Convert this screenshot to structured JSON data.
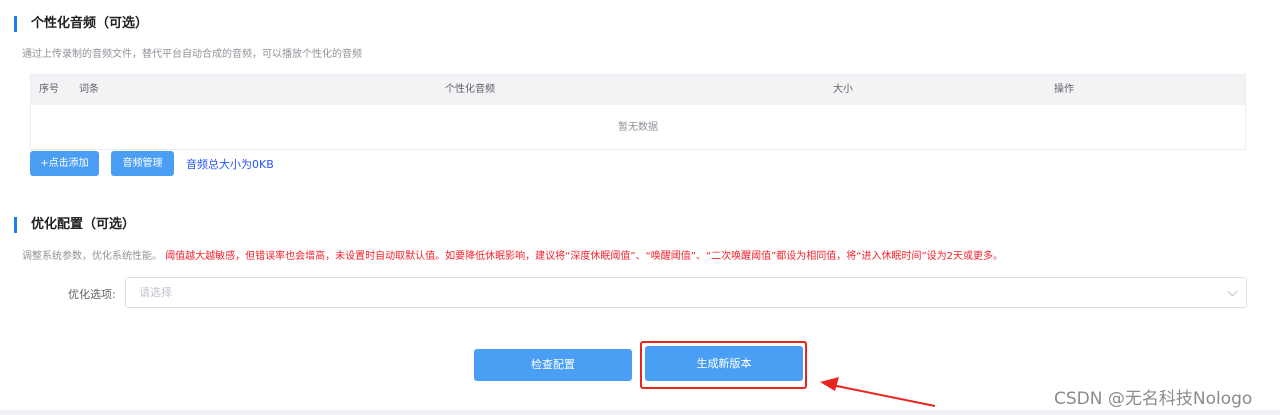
{
  "audio_section": {
    "title": "个性化音频（可选）",
    "description": "通过上传录制的音频文件，替代平台自动合成的音频，可以播放个性化的音频",
    "columns": [
      "序号",
      "词条",
      "个性化音频",
      "大小",
      "操作"
    ],
    "empty_text": "暂无数据",
    "add_button": "+点击添加",
    "manage_button": "音频管理",
    "total_size_text": "音频总大小为0KB"
  },
  "optimize_section": {
    "title": "优化配置（可选）",
    "description": "调整系统参数，优化系统性能。",
    "warning": "阈值越大越敏感，但错误率也会增高，未设置时自动取默认值。如要降低休眠影响，建议将“深度休眠阈值”、“唤醒阈值”、“二次唤醒阈值”都设为相同值，将“进入休眠时间”设为2天或更多。",
    "option_label": "优化选项:",
    "option_placeholder": "请选择"
  },
  "actions": {
    "check_button": "检查配置",
    "generate_button": "生成新版本"
  },
  "watermark": "CSDN @无名科技Nologo",
  "colors": {
    "accent": "#1e7fe6",
    "button": "#4a9ff5",
    "warning": "#f5222d",
    "highlight": "#e8251e",
    "link_blue": "#2656ff"
  },
  "icons": [
    "chevron-down-icon",
    "arrow-annotation"
  ]
}
